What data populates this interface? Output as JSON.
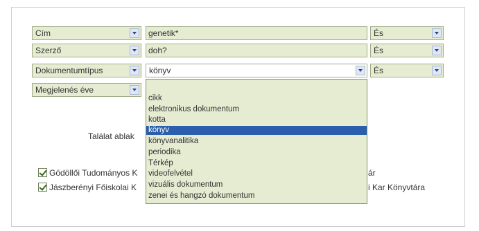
{
  "rows": [
    {
      "field": "Cím",
      "value": "genetik*",
      "operator": "És"
    },
    {
      "field": "Szerző",
      "value": "doh?",
      "operator": "És"
    },
    {
      "field": "Dokumentumtípus",
      "value": "könyv",
      "operator": "És"
    },
    {
      "field": "Megjelenés éve"
    }
  ],
  "result_window_label": "Találat ablak",
  "libraries": [
    {
      "left": "Gödöllői Tudományos K",
      "right": "ár",
      "checked": true
    },
    {
      "left": "Jászberényi Főiskolai K",
      "right": "i Kar Könyvtára",
      "checked": true
    }
  ],
  "doc_type_options": [
    "",
    "cikk",
    "elektronikus dokumentum",
    "kotta",
    "könyv",
    "könyvanalitika",
    "periodika",
    "Térkép",
    "videofelvétel",
    "vizuális dokumentum",
    "zenei és hangzó dokumentum"
  ],
  "selected_option": "könyv",
  "colors": {
    "field_bg": "#e6ecd2",
    "field_border": "#9fad86",
    "selection_bg": "#2b5fad"
  },
  "icons": {
    "dropdown": "chevron-down-icon",
    "checkbox": "checkmark-icon"
  }
}
